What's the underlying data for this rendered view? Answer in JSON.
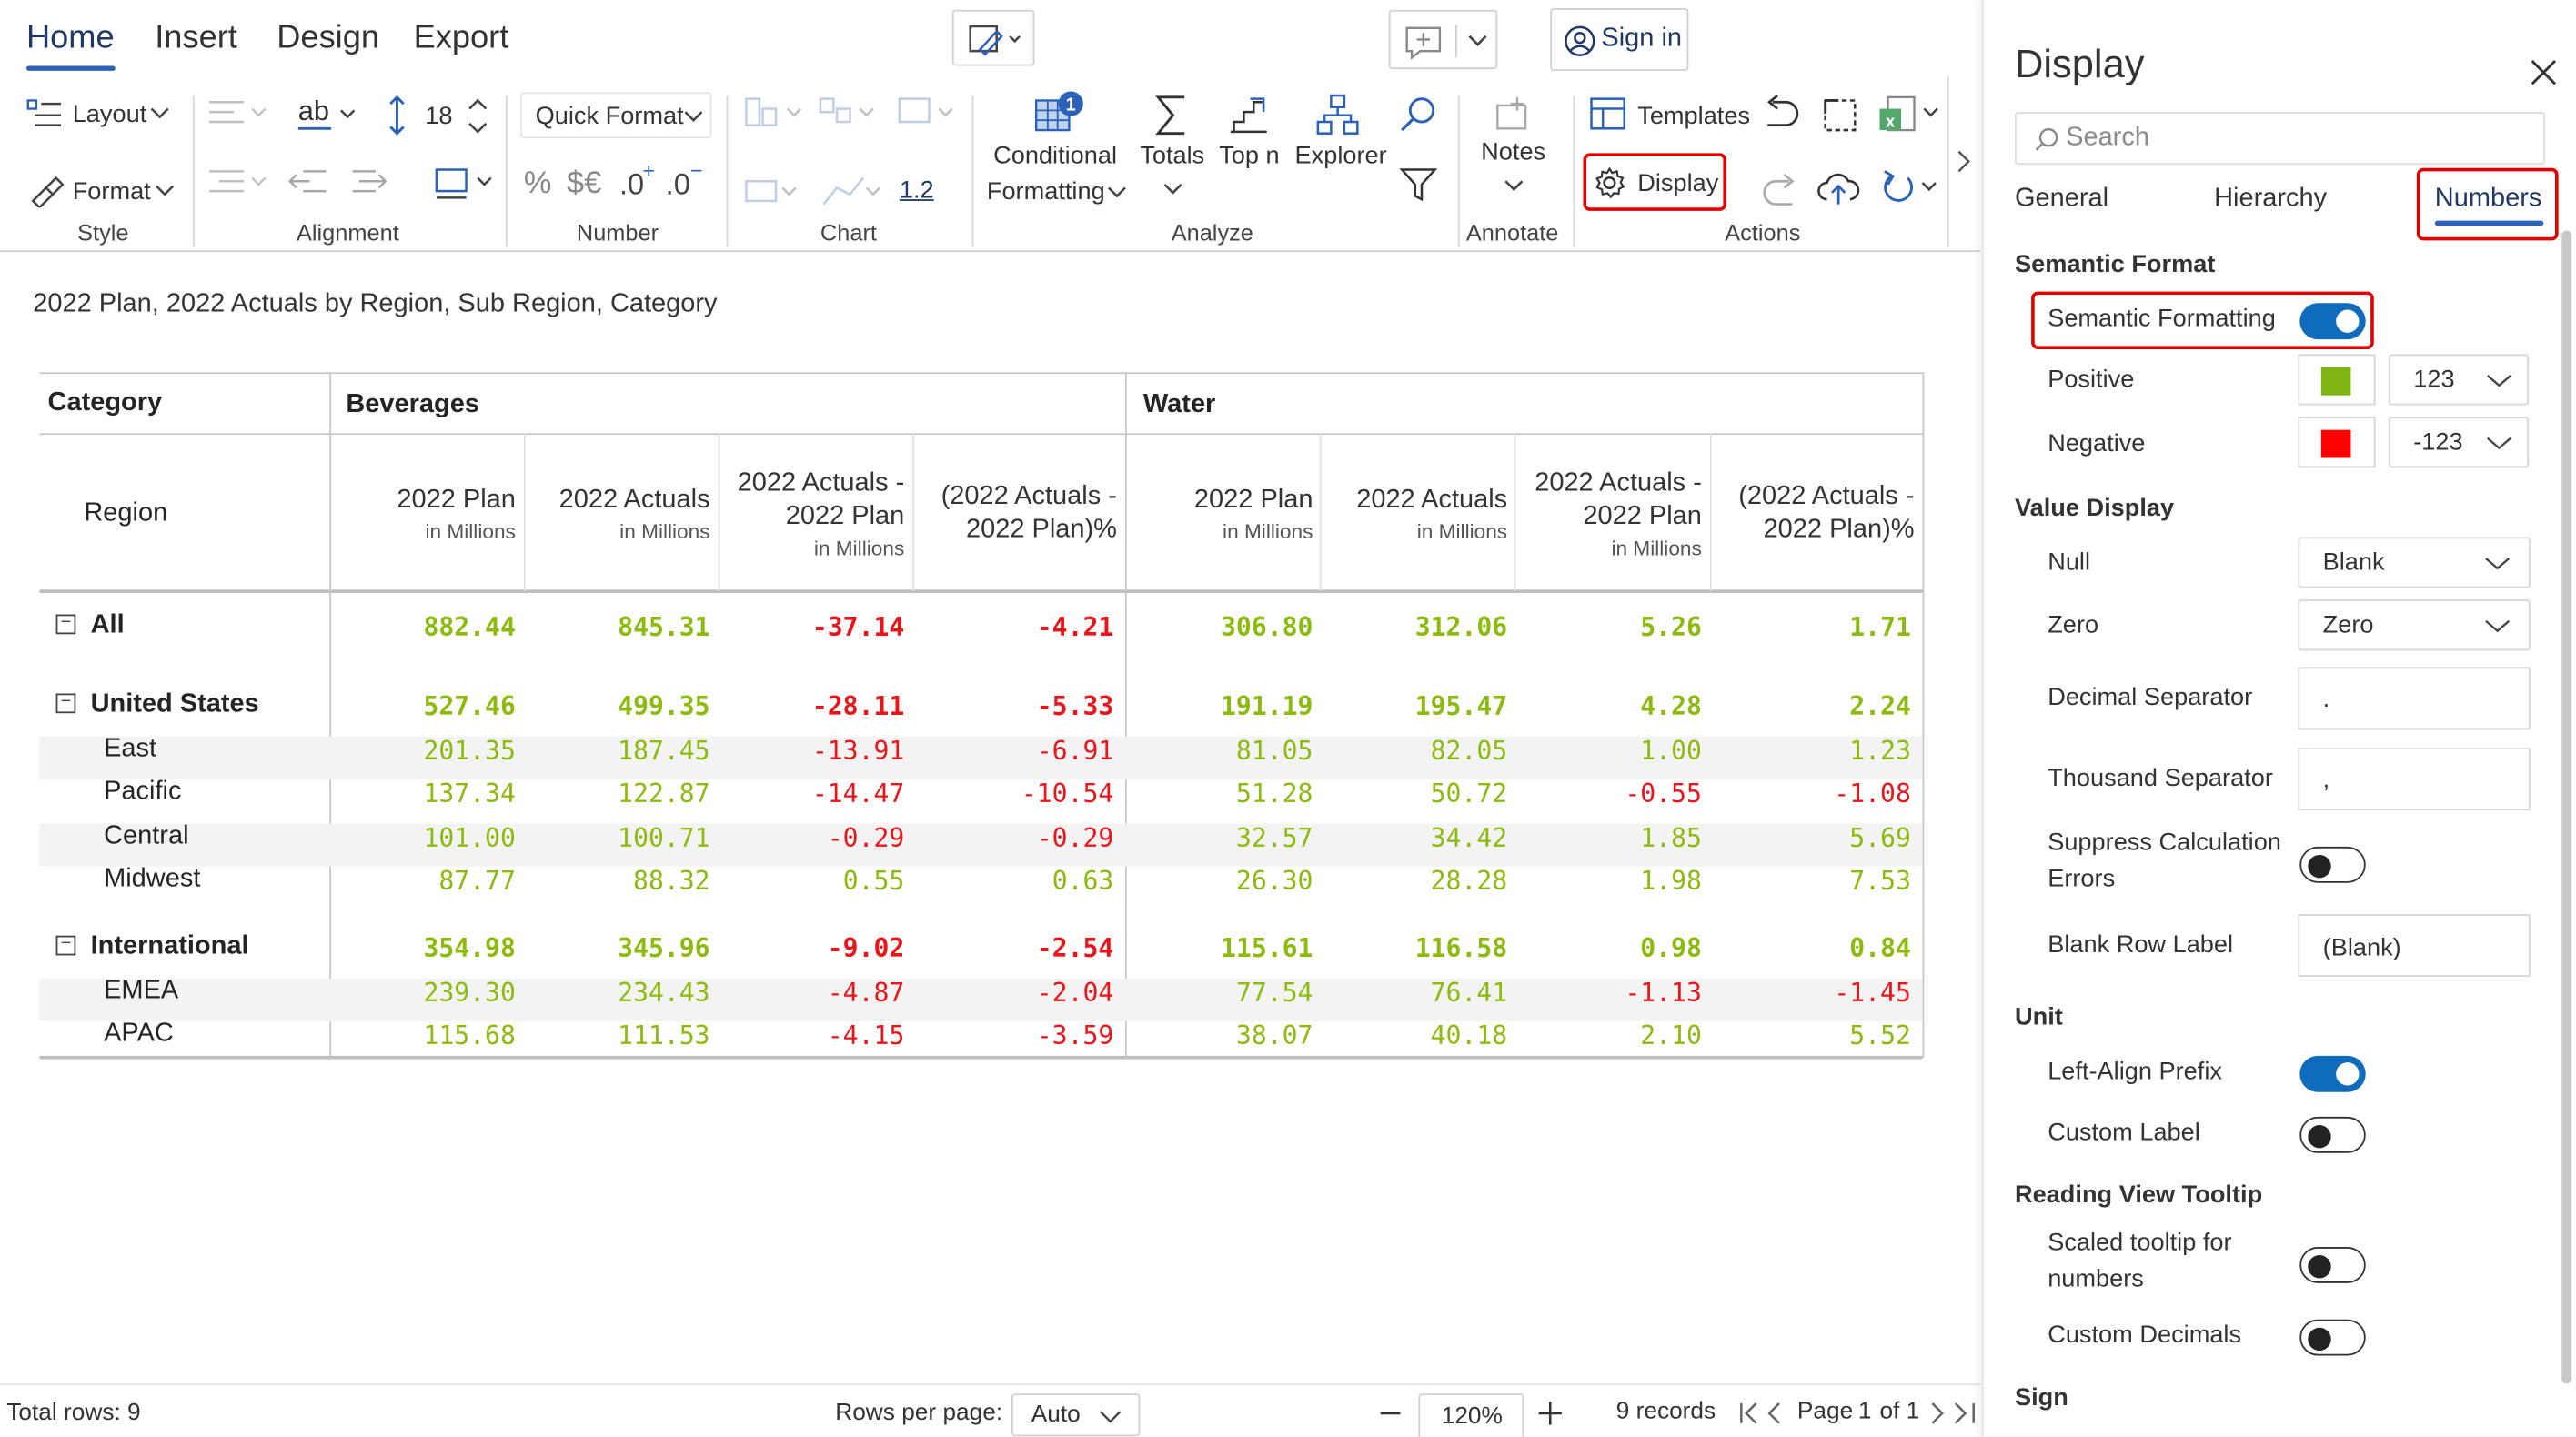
{
  "ribbon": {
    "tabs": [
      "Home",
      "Insert",
      "Design",
      "Export"
    ],
    "sign_in": "Sign in",
    "style": {
      "layout": "Layout",
      "format": "Format",
      "label": "Style"
    },
    "alignment": {
      "font_size": "18",
      "label": "Alignment"
    },
    "number": {
      "quick_format": "Quick Format",
      "pct": "%",
      "currency": "$€",
      "label": "Number"
    },
    "chart": {
      "scale": "1.2",
      "label": "Chart"
    },
    "analyze": {
      "conditional": "Conditional",
      "formatting": "Formatting",
      "totals": "Totals",
      "topn": "Top n",
      "explorer": "Explorer",
      "label": "Analyze",
      "badge": "1"
    },
    "annotate": {
      "notes": "Notes",
      "label": "Annotate"
    },
    "actions": {
      "templates": "Templates",
      "display": "Display",
      "label": "Actions"
    }
  },
  "report": {
    "title": "2022 Plan, 2022 Actuals by Region, Sub Region, Category",
    "category_label": "Category",
    "region_label": "Region",
    "groups": [
      "Beverages",
      "Water"
    ],
    "columns": [
      {
        "line1": "2022 Plan",
        "line2": "",
        "sub": "in Millions"
      },
      {
        "line1": "2022 Actuals",
        "line2": "",
        "sub": "in Millions"
      },
      {
        "line1": "2022 Actuals -",
        "line2": "2022 Plan",
        "sub": "in Millions"
      },
      {
        "line1": "(2022 Actuals -",
        "line2": "2022 Plan)%",
        "sub": ""
      },
      {
        "line1": "2022 Plan",
        "line2": "",
        "sub": "in Millions"
      },
      {
        "line1": "2022 Actuals",
        "line2": "",
        "sub": "in Millions"
      },
      {
        "line1": "2022 Actuals -",
        "line2": "2022 Plan",
        "sub": "in Millions"
      },
      {
        "line1": "(2022 Actuals -",
        "line2": "2022 Plan)%",
        "sub": ""
      }
    ],
    "rows": [
      {
        "label": "All",
        "level": 0,
        "values": [
          "882.44",
          "845.31",
          "-37.14",
          "-4.21",
          "306.80",
          "312.06",
          "5.26",
          "1.71"
        ]
      },
      {
        "label": "United States",
        "level": 0,
        "values": [
          "527.46",
          "499.35",
          "-28.11",
          "-5.33",
          "191.19",
          "195.47",
          "4.28",
          "2.24"
        ]
      },
      {
        "label": "East",
        "level": 1,
        "values": [
          "201.35",
          "187.45",
          "-13.91",
          "-6.91",
          "81.05",
          "82.05",
          "1.00",
          "1.23"
        ]
      },
      {
        "label": "Pacific",
        "level": 1,
        "values": [
          "137.34",
          "122.87",
          "-14.47",
          "-10.54",
          "51.28",
          "50.72",
          "-0.55",
          "-1.08"
        ]
      },
      {
        "label": "Central",
        "level": 1,
        "values": [
          "101.00",
          "100.71",
          "-0.29",
          "-0.29",
          "32.57",
          "34.42",
          "1.85",
          "5.69"
        ]
      },
      {
        "label": "Midwest",
        "level": 1,
        "values": [
          "87.77",
          "88.32",
          "0.55",
          "0.63",
          "26.30",
          "28.28",
          "1.98",
          "7.53"
        ]
      },
      {
        "label": "International",
        "level": 0,
        "values": [
          "354.98",
          "345.96",
          "-9.02",
          "-2.54",
          "115.61",
          "116.58",
          "0.98",
          "0.84"
        ]
      },
      {
        "label": "EMEA",
        "level": 1,
        "values": [
          "239.30",
          "234.43",
          "-4.87",
          "-2.04",
          "77.54",
          "76.41",
          "-1.13",
          "-1.45"
        ]
      },
      {
        "label": "APAC",
        "level": 1,
        "values": [
          "115.68",
          "111.53",
          "-4.15",
          "-3.59",
          "38.07",
          "40.18",
          "2.10",
          "5.52"
        ]
      }
    ],
    "colors": {
      "positive": "#8dba0e",
      "negative": "#e8161b"
    }
  },
  "footer": {
    "total_rows": "Total rows: 9",
    "rows_per_page_label": "Rows per page:",
    "rows_per_page_value": "Auto",
    "zoom": "120%",
    "records": "9 records",
    "page_label": "Page",
    "page_current": "1",
    "page_of": "of 1"
  },
  "panel": {
    "title": "Display",
    "search_placeholder": "Search",
    "tabs": [
      "General",
      "Hierarchy",
      "Numbers"
    ],
    "semantic_format_heading": "Semantic Format",
    "semantic_formatting": "Semantic Formatting",
    "positive": "Positive",
    "positive_format": "123",
    "positive_color": "#7fb514",
    "negative": "Negative",
    "negative_format": "-123",
    "negative_color": "#ff0000",
    "value_display_heading": "Value Display",
    "null": "Null",
    "null_value": "Blank",
    "zero": "Zero",
    "zero_value": "Zero",
    "decimal_separator": "Decimal Separator",
    "decimal_value": ".",
    "thousand_separator": "Thousand Separator",
    "thousand_value": ",",
    "suppress_1": "Suppress Calculation",
    "suppress_2": "Errors",
    "blank_row_label": "Blank Row Label",
    "blank_row_value": "(Blank)",
    "unit_heading": "Unit",
    "left_align_prefix": "Left-Align Prefix",
    "custom_label": "Custom Label",
    "reading_view_heading": "Reading View Tooltip",
    "scaled_1": "Scaled tooltip for",
    "scaled_2": "numbers",
    "custom_decimals": "Custom Decimals",
    "sign_heading": "Sign",
    "toggles": {
      "semantic": true,
      "suppress": false,
      "left_align": true,
      "custom_label": false,
      "scaled": false,
      "custom_decimals": false
    }
  }
}
